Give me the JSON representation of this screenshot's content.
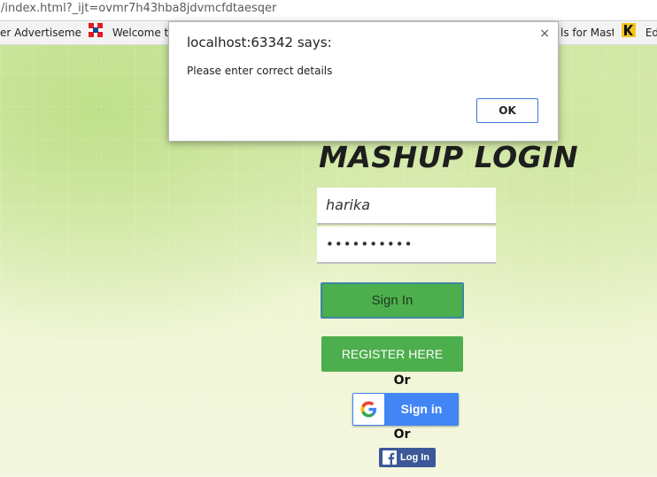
{
  "browser": {
    "url": "/index.html?_ijt=ovmr7h43hba8jdvmcfdtaesqer",
    "bookmarks": [
      {
        "label": "er Advertisement",
        "icon": "document-icon"
      },
      {
        "label": "Welcome to",
        "icon": "hdfc-icon"
      },
      {
        "label": "ls for Maste",
        "icon": "document-icon"
      },
      {
        "label": "Edu",
        "icon": "k-logo-icon"
      }
    ]
  },
  "alert": {
    "title": "localhost:63342 says:",
    "message": "Please enter correct details",
    "ok_label": "OK",
    "close_label": "×"
  },
  "login": {
    "title": "MASHUP LOGIN",
    "username_value": "harika",
    "password_value": "••••••••••",
    "signin_label": "Sign In",
    "register_label": "REGISTER HERE",
    "or_label": "Or",
    "google_label": "Sign in",
    "facebook_label": "Log In"
  },
  "colors": {
    "button_green": "#4cae4c",
    "google_blue": "#4285f4",
    "facebook_blue": "#3b5998",
    "background": "#e8f1c8"
  }
}
